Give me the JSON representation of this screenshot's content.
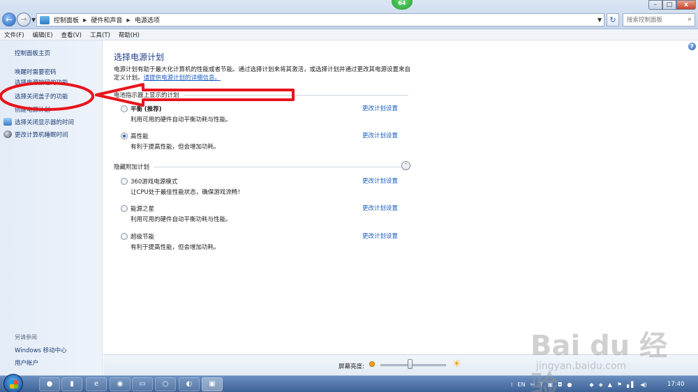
{
  "window": {
    "breadcrumb": [
      "控制面板",
      "硬件和声音",
      "电源选项"
    ],
    "search_placeholder": "搜索控制面板",
    "badge": "64",
    "controls": {
      "minimize": "–",
      "maximize": "□",
      "close": "x"
    }
  },
  "menubar": [
    "文件(F)",
    "编辑(E)",
    "查看(V)",
    "工具(T)",
    "帮助(H)"
  ],
  "sidebar": {
    "items": [
      "控制面板主页",
      "唤醒时需要密码",
      "选择电源按钮的功能",
      "选择关闭盖子的功能",
      "创建电源计划",
      "选择关闭显示器的时间",
      "更改计算机睡眠时间"
    ],
    "see_also": "另请参阅",
    "see_also_items": [
      "Windows 移动中心",
      "用户帐户"
    ]
  },
  "main": {
    "title": "选择电源计划",
    "description": "电源计划有助于最大化计算机的性能或者节能。通过选择计划来将其激活，或选择计划并通过更改其电源设置来自定义计划。",
    "learn_more": "请提供电源计划的详细信息。",
    "group1": "电池指示器上显示的计划",
    "group2": "隐藏附加计划",
    "change_link": "更改计划设置",
    "plans": [
      {
        "name": "平衡",
        "tag": "(推荐)",
        "desc": "利用可用的硬件自动平衡功耗与性能。",
        "selected": false
      },
      {
        "name": "高性能",
        "tag": "",
        "desc": "有利于提高性能，但会增加功耗。",
        "selected": true
      },
      {
        "name": "360游戏电源模式",
        "tag": "",
        "desc": "让CPU处于最佳性能状态，确保游戏流畅！",
        "selected": false
      },
      {
        "name": "能源之星",
        "tag": "",
        "desc": "利用可用的硬件自动平衡功耗与性能。",
        "selected": false
      },
      {
        "name": "超级节能",
        "tag": "",
        "desc": "有利于提高性能，但会增加功耗。",
        "selected": false
      }
    ]
  },
  "brightness": {
    "label": "屏幕亮度:",
    "level": 0.45
  },
  "taskbar": {
    "lang": "EN",
    "time": "17:40"
  },
  "watermark": {
    "brand": "Bai du 经验",
    "url": "jingyan.baidu.com"
  },
  "colors": {
    "accent": "#1a5dbd",
    "annotation": "#e8141c"
  }
}
